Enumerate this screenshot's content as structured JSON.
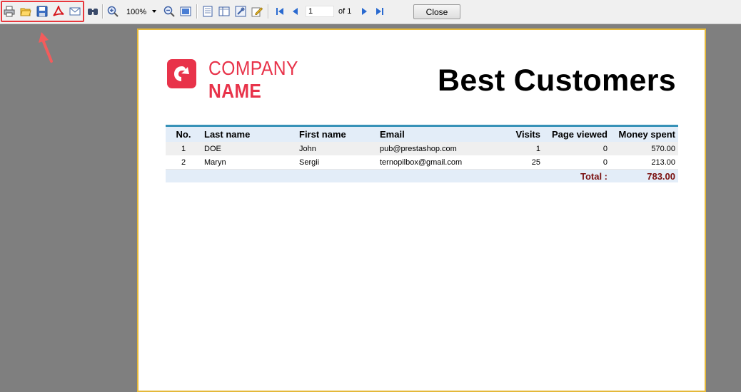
{
  "toolbar": {
    "zoom": "100%",
    "current_page": "1",
    "page_of": "of 1",
    "close_label": "Close",
    "icons": [
      "printer-icon",
      "open-icon",
      "save-icon",
      "pdf-icon",
      "email-icon",
      "find-icon",
      "zoom-in-icon",
      "zoom-out-icon",
      "fit-page-icon",
      "single-page-icon",
      "two-page-icon",
      "settings-icon",
      "edit-icon",
      "first-page-icon",
      "prev-page-icon",
      "next-page-icon",
      "last-page-icon"
    ]
  },
  "report": {
    "company_line1": "COMPANY",
    "company_line2": "NAME",
    "title": "Best Customers",
    "brand_color": "#e8334a",
    "columns": [
      "No.",
      "Last name",
      "First name",
      "Email",
      "Visits",
      "Page viewed",
      "Money spent"
    ],
    "rows": [
      {
        "no": "1",
        "last": "DOE",
        "first": "John",
        "email": "pub@prestashop.com",
        "visits": "1",
        "pages": "0",
        "money": "570.00"
      },
      {
        "no": "2",
        "last": "Maryn",
        "first": "Sergii",
        "email": "ternopilbox@gmail.com",
        "visits": "25",
        "pages": "0",
        "money": "213.00"
      }
    ],
    "total_label": "Total :",
    "total_value": "783.00"
  },
  "colors": {
    "highlight": "#e8383d",
    "page_border": "#e4b83a",
    "table_rule": "#3792b8",
    "total_text": "#7a1010"
  }
}
